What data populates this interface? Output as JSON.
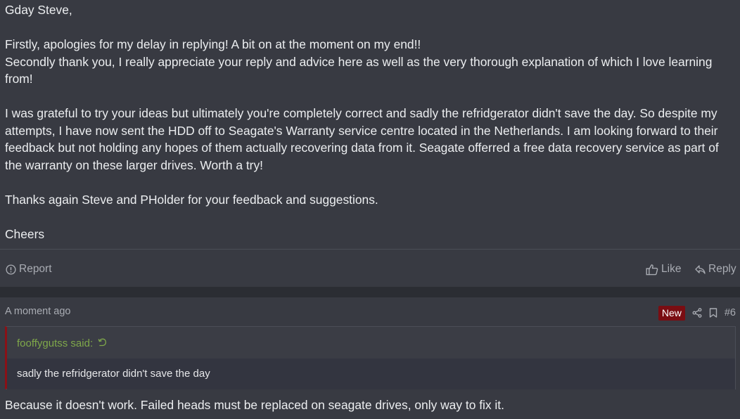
{
  "post1": {
    "lines": [
      "Gday Steve,",
      "",
      "Firstly, apologies for my delay in replying! A bit on at the moment on my end!!",
      "Secondly thank you, I really appreciate your reply and advice here as well as the very thorough explanation of which I love learning from!",
      "",
      "I was grateful to try your ideas but ultimately you're completely correct and sadly the refridgerator didn't save the day. So despite my attempts, I have now sent the HDD off to Seagate's Warranty service centre located in the Netherlands. I am looking forward to their feedback but not holding any hopes of them actually recovering data from it. Seagate offerred a free data recovery service as part of the warranty on these larger drives. Worth a try!",
      "",
      "Thanks again Steve and PHolder for your feedback and suggestions.",
      "",
      "Cheers"
    ],
    "actions": {
      "report_label": "Report",
      "like_label": "Like",
      "reply_label": "Reply"
    }
  },
  "post2": {
    "time": "A moment ago",
    "new_badge": "New",
    "post_number": "#6",
    "quote": {
      "author": "fooffygutss said:",
      "text": "sadly the refridgerator didn't save the day"
    },
    "body": "Because it doesn't work. Failed heads must be replaced on seagate drives, only way to fix it."
  },
  "icons": {
    "report": "alert-circle-icon",
    "like": "thumbs-up-icon",
    "reply": "reply-arrow-icon",
    "share": "share-icon",
    "bookmark": "bookmark-icon",
    "quote_jump": "jump-to-quote-icon"
  },
  "colors": {
    "background": "#2b2d33",
    "post_background": "#383a42",
    "new_badge": "#7a0d12",
    "quote_author": "#7fa84a",
    "quote_border": "#8a1117"
  }
}
